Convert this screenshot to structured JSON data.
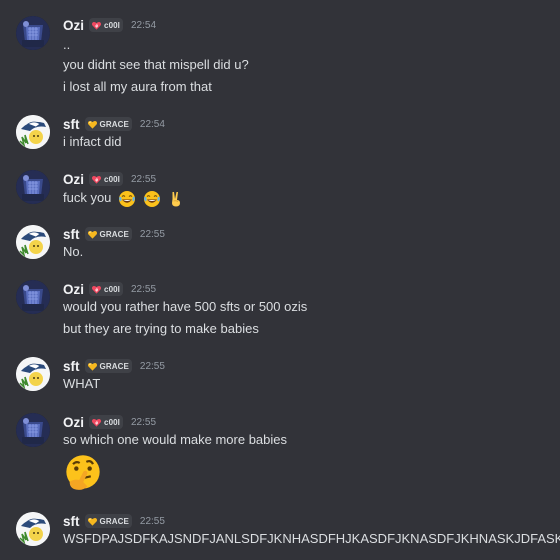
{
  "colors": {
    "background": "#323339",
    "username": "#f2f3f5",
    "message_text": "#dbdee1",
    "timestamp": "#949ba4",
    "tag_background": "#3f4147"
  },
  "messages": [
    {
      "author": "Ozi",
      "tag": "c00l",
      "tag_icon": "flame-heart-icon",
      "time": "22:54",
      "lines": [
        "..",
        "you didnt see that mispell did u?",
        "i lost all my aura from that"
      ]
    },
    {
      "author": "sft",
      "tag": "GRACE",
      "tag_icon": "gold-heart-icon",
      "time": "22:54",
      "lines": [
        "i infact did"
      ]
    },
    {
      "author": "Ozi",
      "tag": "c00l",
      "tag_icon": "flame-heart-icon",
      "time": "22:55",
      "lines": [
        "fuck you"
      ],
      "emojis": [
        "face-with-tears-of-joy-emoji",
        "face-with-tears-of-joy-emoji",
        "victory-hand-emoji"
      ]
    },
    {
      "author": "sft",
      "tag": "GRACE",
      "tag_icon": "gold-heart-icon",
      "time": "22:55",
      "lines": [
        "No."
      ]
    },
    {
      "author": "Ozi",
      "tag": "c00l",
      "tag_icon": "flame-heart-icon",
      "time": "22:55",
      "lines": [
        "would you rather have 500 sfts or 500 ozis",
        "but they are trying to make babies"
      ]
    },
    {
      "author": "sft",
      "tag": "GRACE",
      "tag_icon": "gold-heart-icon",
      "time": "22:55",
      "lines": [
        "WHAT"
      ]
    },
    {
      "author": "Ozi",
      "tag": "c00l",
      "tag_icon": "flame-heart-icon",
      "time": "22:55",
      "lines": [
        "so which one would make more babies"
      ],
      "big_emoji": "thinking-face-emoji"
    },
    {
      "author": "sft",
      "tag": "GRACE",
      "tag_icon": "gold-heart-icon",
      "time": "22:55",
      "lines": [
        "WSFDPAJSDFKAJSNDFJANLSDFJKNHASDFHJKASDFJKNASDFJKHNASKJDFASKJDFKJ"
      ]
    }
  ]
}
